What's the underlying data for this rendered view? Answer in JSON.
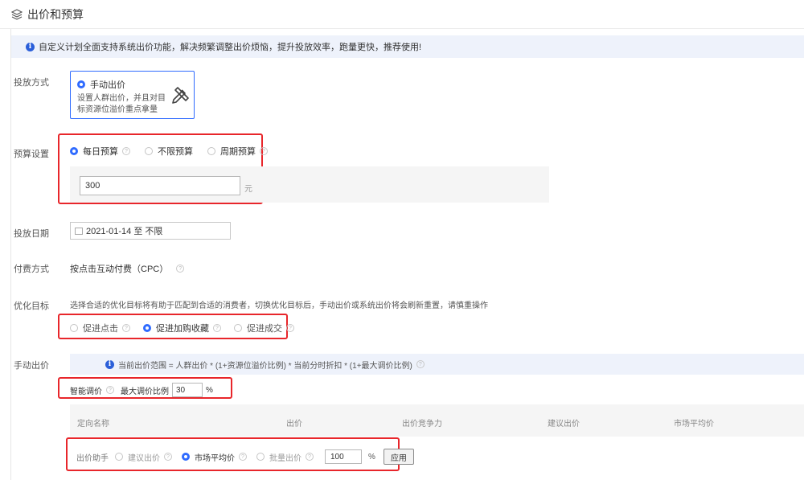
{
  "header": {
    "title": "出价和预算",
    "icon": "layers-icon"
  },
  "notice": {
    "text": "自定义计划全面支持系统出价功能，解决频繁调整出价烦恼，提升投放效率，跑量更快，推荐使用!"
  },
  "labels": {
    "delivery_mode": "投放方式",
    "budget": "预算设置",
    "date": "投放日期",
    "payment": "付费方式",
    "optimize": "优化目标",
    "manual_bid": "手动出价"
  },
  "delivery_mode": {
    "option": "手动出价",
    "description": "设置人群出价，并且对目标资源位溢价重点拿量"
  },
  "budget": {
    "options": [
      "每日预算",
      "不限预算",
      "周期预算"
    ],
    "selected": "每日预算",
    "value": "300",
    "unit": "元"
  },
  "date": {
    "value": "2021-01-14 至 不限"
  },
  "payment": {
    "value": "按点击互动付费（CPC）"
  },
  "optimize": {
    "hint": "选择合适的优化目标将有助于匹配到合适的消费者，切换优化目标后，手动出价或系统出价将会刷新重置，请慎重操作",
    "options": [
      "促进点击",
      "促进加购收藏",
      "促进成交"
    ],
    "selected": "促进加购收藏"
  },
  "manual_bid": {
    "range_text": "当前出价范围 = 人群出价 * (1+资源位溢价比例) * 当前分时折扣 * (1+最大调价比例)",
    "smart_label": "智能调价",
    "max_ratio_label": "最大调价比例",
    "max_ratio_value": "30",
    "percent": "%"
  },
  "table": {
    "columns": [
      "定向名称",
      "出价",
      "出价竞争力",
      "建议出价",
      "市场平均价"
    ]
  },
  "helper": {
    "label": "出价助手",
    "options": [
      "建议出价",
      "市场平均价",
      "批量出价"
    ],
    "selected": "市场平均价",
    "value": "100",
    "percent": "%",
    "apply": "应用"
  },
  "colors": {
    "accent": "#2f6bff",
    "highlight_border": "#e8262b",
    "notice_bg": "#eef2fb"
  }
}
